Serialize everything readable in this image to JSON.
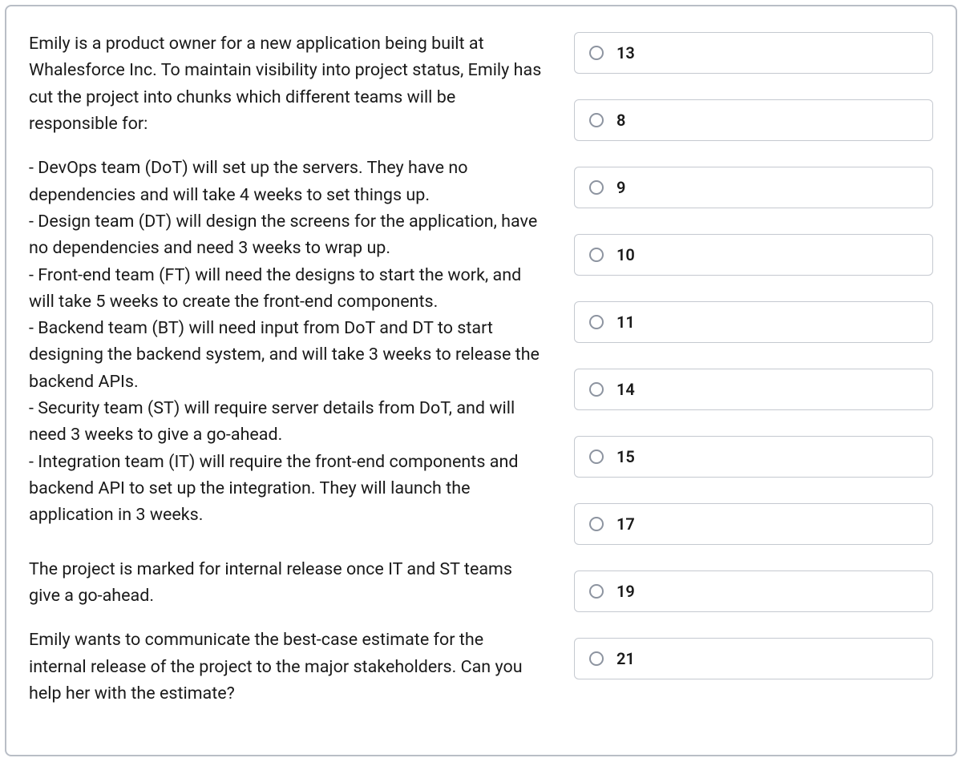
{
  "question": {
    "intro": "Emily is a product owner for a new application being built at Whalesforce Inc. To maintain visibility into project status, Emily has cut the project into chunks which different teams will be responsible for:",
    "bullets": [
      "- DevOps team (DoT) will set up the servers. They have no dependencies and will take 4 weeks to set things up.",
      "- Design team (DT) will design the screens for the application, have no dependencies and need 3 weeks to wrap up.",
      "- Front-end team (FT) will need the designs to start the work, and will take 5 weeks to create the front-end components.",
      "- Backend team (BT) will need input from DoT and DT to start designing the backend system, and will take 3 weeks to release the backend APIs.",
      "- Security team (ST) will require server details from DoT, and will need 3 weeks to give a go-ahead.",
      "- Integration team (IT) will require the front-end components and backend API to set up the integration. They will launch the application in 3 weeks."
    ],
    "release_condition": "The project is marked for internal release once IT and ST teams give a go-ahead.",
    "ask": "Emily wants to communicate the best-case estimate for the internal release of the project to the major stakeholders. Can you help her with the estimate?"
  },
  "options": [
    {
      "label": "13"
    },
    {
      "label": "8"
    },
    {
      "label": "9"
    },
    {
      "label": "10"
    },
    {
      "label": "11"
    },
    {
      "label": "14"
    },
    {
      "label": "15"
    },
    {
      "label": "17"
    },
    {
      "label": "19"
    },
    {
      "label": "21"
    }
  ]
}
